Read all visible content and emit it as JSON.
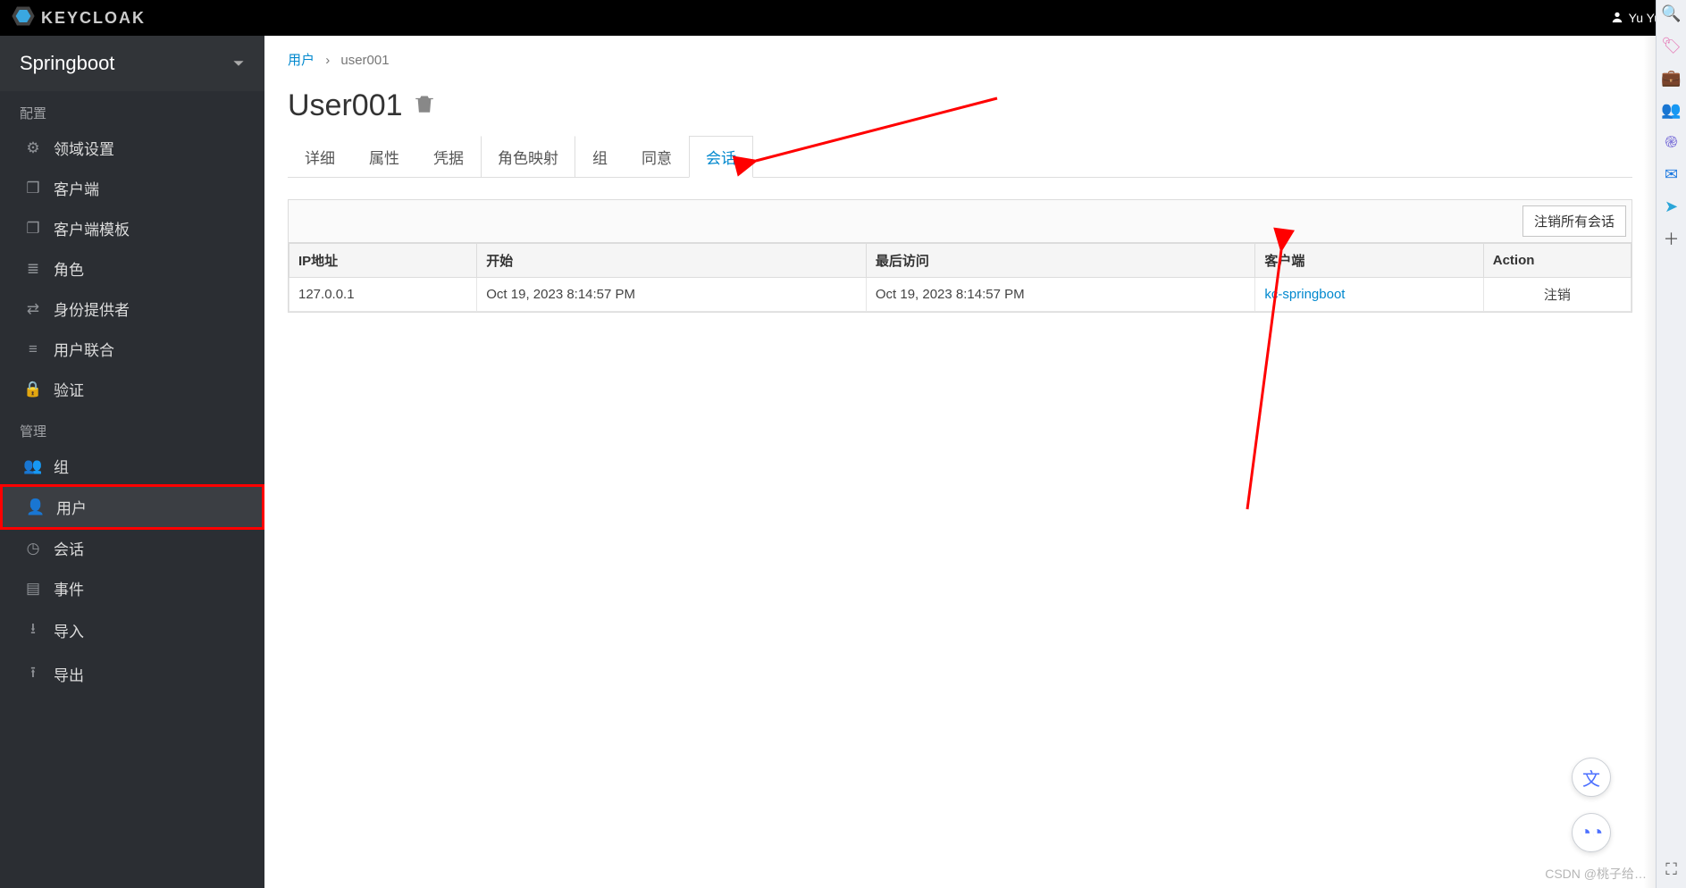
{
  "header": {
    "brand": "KEYCLOAK",
    "user_name": "Yu Yu"
  },
  "sidebar": {
    "realm": "Springboot",
    "section_configure": "配置",
    "section_manage": "管理",
    "configure_items": [
      {
        "label": "领域设置"
      },
      {
        "label": "客户端"
      },
      {
        "label": "客户端模板"
      },
      {
        "label": "角色"
      },
      {
        "label": "身份提供者"
      },
      {
        "label": "用户联合"
      },
      {
        "label": "验证"
      }
    ],
    "manage_items": [
      {
        "label": "组"
      },
      {
        "label": "用户"
      },
      {
        "label": "会话"
      },
      {
        "label": "事件"
      },
      {
        "label": "导入"
      },
      {
        "label": "导出"
      }
    ]
  },
  "breadcrumb": {
    "root": "用户",
    "sep": "›",
    "current": "user001"
  },
  "page": {
    "title": "User001"
  },
  "tabs": [
    {
      "label": "详细"
    },
    {
      "label": "属性"
    },
    {
      "label": "凭据"
    },
    {
      "label": "角色映射"
    },
    {
      "label": "组"
    },
    {
      "label": "同意"
    },
    {
      "label": "会话"
    }
  ],
  "table": {
    "logout_all": "注销所有会话",
    "headers": {
      "ip": "IP地址",
      "start": "开始",
      "last": "最后访问",
      "client": "客户端",
      "action": "Action"
    },
    "rows": [
      {
        "ip": "127.0.0.1",
        "start": "Oct 19, 2023 8:14:57 PM",
        "last": "Oct 19, 2023 8:14:57 PM",
        "client": "kc-springboot",
        "action": "注销"
      }
    ]
  },
  "watermark": "CSDN @桃子给…"
}
